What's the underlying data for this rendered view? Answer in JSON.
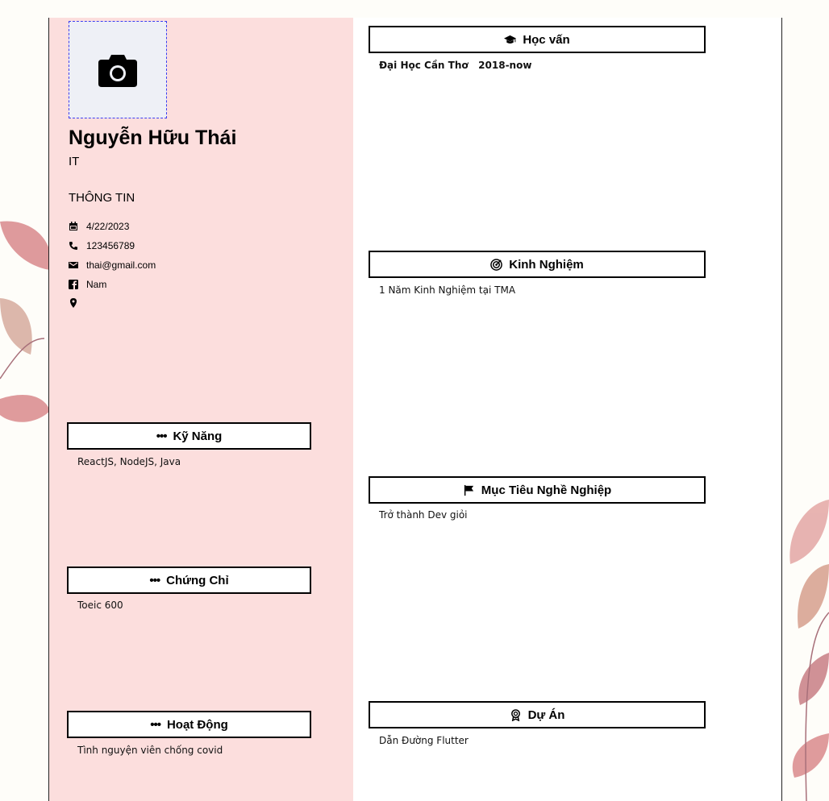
{
  "profile": {
    "name": "Nguyễn Hữu Thái",
    "job": "IT",
    "info_title": "THÔNG TIN",
    "birthday": "4/22/2023",
    "phone": "123456789",
    "email": "thai@gmail.com",
    "gender": "Nam",
    "address": ""
  },
  "left_sections": [
    {
      "icon": "dots-icon",
      "title": "Kỹ Năng",
      "content": "ReactJS, NodeJS,  Java"
    },
    {
      "icon": "dots-icon",
      "title": "Chứng Chỉ",
      "content": "Toeic 600"
    },
    {
      "icon": "dots-icon",
      "title": "Hoạt Động",
      "content": "Tình nguyện viên chống covid"
    }
  ],
  "right_sections": [
    {
      "icon": "graduation-cap-icon",
      "title": "Học vấn",
      "content_a": "Đại Học Cần Thơ",
      "content_b": "2018-now"
    },
    {
      "icon": "target-icon",
      "title": "Kinh Nghiệm",
      "content": "1 Năm Kinh Nghiệm tại TMA"
    },
    {
      "icon": "flag-icon",
      "title": "Mục Tiêu Nghề Nghiệp",
      "content": "Trở thành Dev giỏi"
    },
    {
      "icon": "award-icon",
      "title": "Dự Án",
      "content": "Dẫn Đường Flutter"
    }
  ],
  "colors": {
    "left_column_bg": "#fcdedd",
    "page_bg": "#ffffff",
    "leaf": "#d9888b"
  }
}
